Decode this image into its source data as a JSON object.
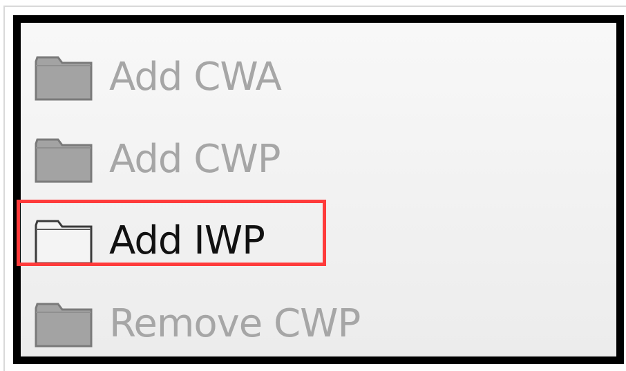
{
  "menu": {
    "items": [
      {
        "label": "Add CWA",
        "icon": "folder-icon",
        "enabled": false
      },
      {
        "label": "Add CWP",
        "icon": "folder-icon",
        "enabled": false
      },
      {
        "label": "Add IWP",
        "icon": "folder-icon",
        "enabled": true
      },
      {
        "label": "Remove CWP",
        "icon": "folder-icon",
        "enabled": false
      }
    ]
  },
  "colors": {
    "highlight": "#ff3b3b",
    "disabled_text": "#a6a6a6",
    "enabled_text": "#111111",
    "panel_border": "#000000"
  }
}
